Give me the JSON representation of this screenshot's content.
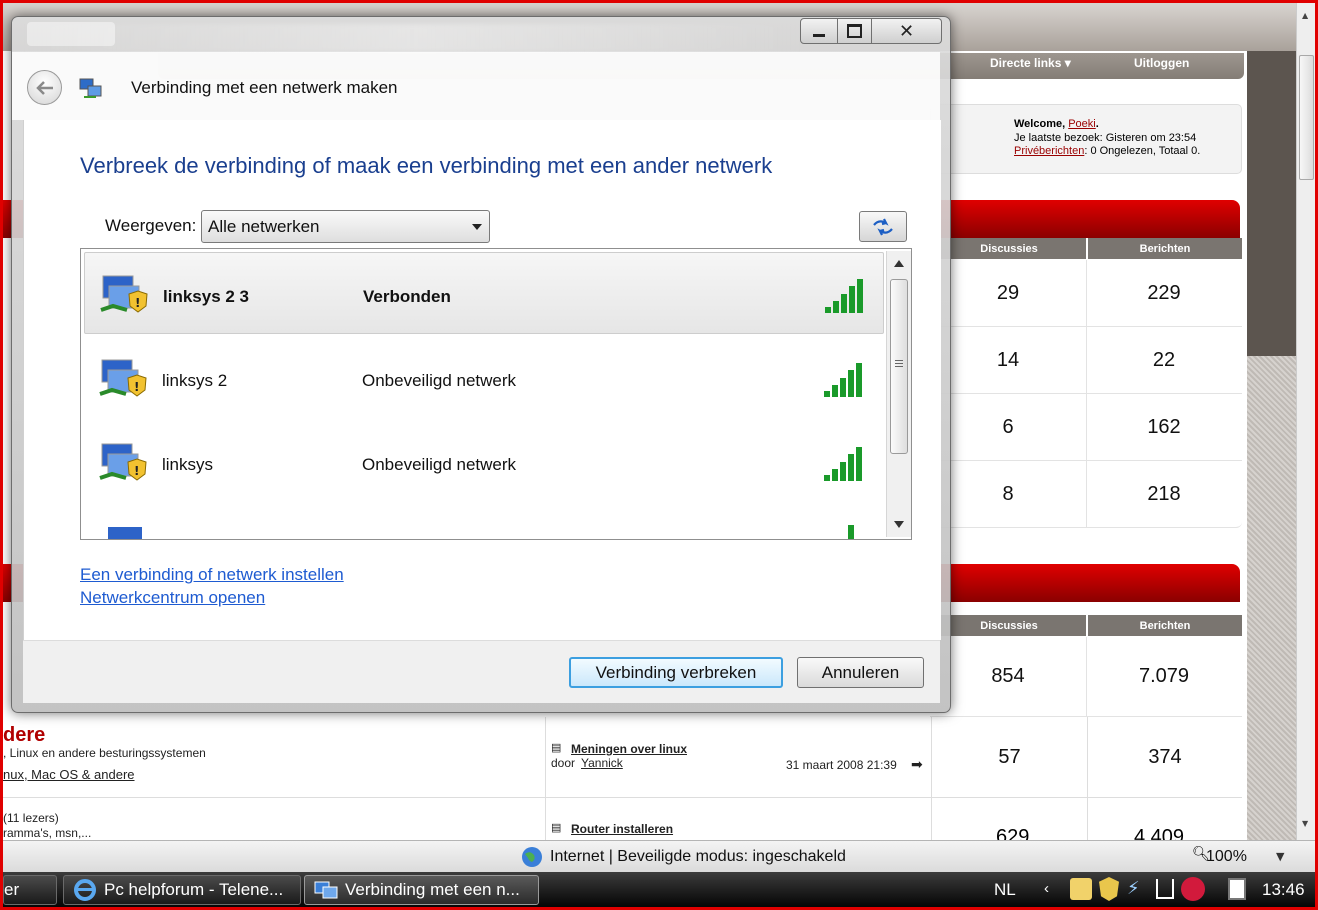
{
  "forum": {
    "nav": {
      "direct_links": "Directe links ▾",
      "logout": "Uitloggen"
    },
    "welcome": {
      "prefix": "Welcome, ",
      "user": "Poeki",
      "suffix": ".",
      "last_visit": "Je laatste bezoek: Gisteren om 23:54",
      "pm_link": "Privéberichten",
      "pm_text": ": 0 Ongelezen, Totaal 0."
    },
    "section1": {
      "col_discussions": "Discussies",
      "col_posts": "Berichten",
      "rows": [
        {
          "discussions": "29",
          "posts": "229"
        },
        {
          "discussions": "14",
          "posts": "22"
        },
        {
          "discussions": "6",
          "posts": "162"
        },
        {
          "discussions": "8",
          "posts": "218"
        }
      ]
    },
    "section2": {
      "col_discussions": "Discussies",
      "col_posts": "Berichten",
      "rows": [
        {
          "discussions": "854",
          "posts": "7.079"
        },
        {
          "discussions": "57",
          "posts": "374"
        },
        {
          "discussions": "629",
          "posts": "4.409"
        }
      ]
    },
    "forum_row1": {
      "title": "dere",
      "desc": ", Linux en andere besturingssystemen",
      "sub": "nux, Mac OS & andere",
      "last_thread": "Meningen over linux",
      "by": "door ",
      "author": "Yannick",
      "date": "31 maart 2008 21:39"
    },
    "forum_row2": {
      "readers": "(11 lezers)",
      "desc": "ramma's, msn,...",
      "last_thread": "Router installeren"
    }
  },
  "ie": {
    "status": "Internet | Beveiligde modus: ingeschakeld",
    "zoom": "100%"
  },
  "taskbar": {
    "cut_label": "er",
    "item1": "Pc helpforum - Telene...",
    "item2": "Verbinding met een n...",
    "lang": "NL",
    "time": "13:46"
  },
  "dialog": {
    "window_title": "Verbinding met een netwerk maken",
    "heading": "Verbreek de verbinding of maak een verbinding met een ander netwerk",
    "show_label": "Weergeven:",
    "show_value": "Alle netwerken",
    "networks": [
      {
        "name": "linksys 2 3",
        "status": "Verbonden"
      },
      {
        "name": "linksys 2",
        "status": "Onbeveiligd netwerk"
      },
      {
        "name": "linksys",
        "status": "Onbeveiligd netwerk"
      }
    ],
    "link_setup": "Een verbinding of netwerk instellen",
    "link_center": "Netwerkcentrum openen",
    "btn_disconnect": "Verbinding verbreken",
    "btn_cancel": "Annuleren"
  },
  "colors": {
    "heading_blue": "#1a3f8f",
    "link_blue": "#1e5bd1",
    "forum_red": "#9a0000",
    "signal_green": "#1a9a2a"
  },
  "icons": {
    "network": "wireless-shield-network-icon",
    "signal": "signal-strength-icon",
    "refresh": "refresh-icon",
    "back": "back-arrow-icon"
  }
}
